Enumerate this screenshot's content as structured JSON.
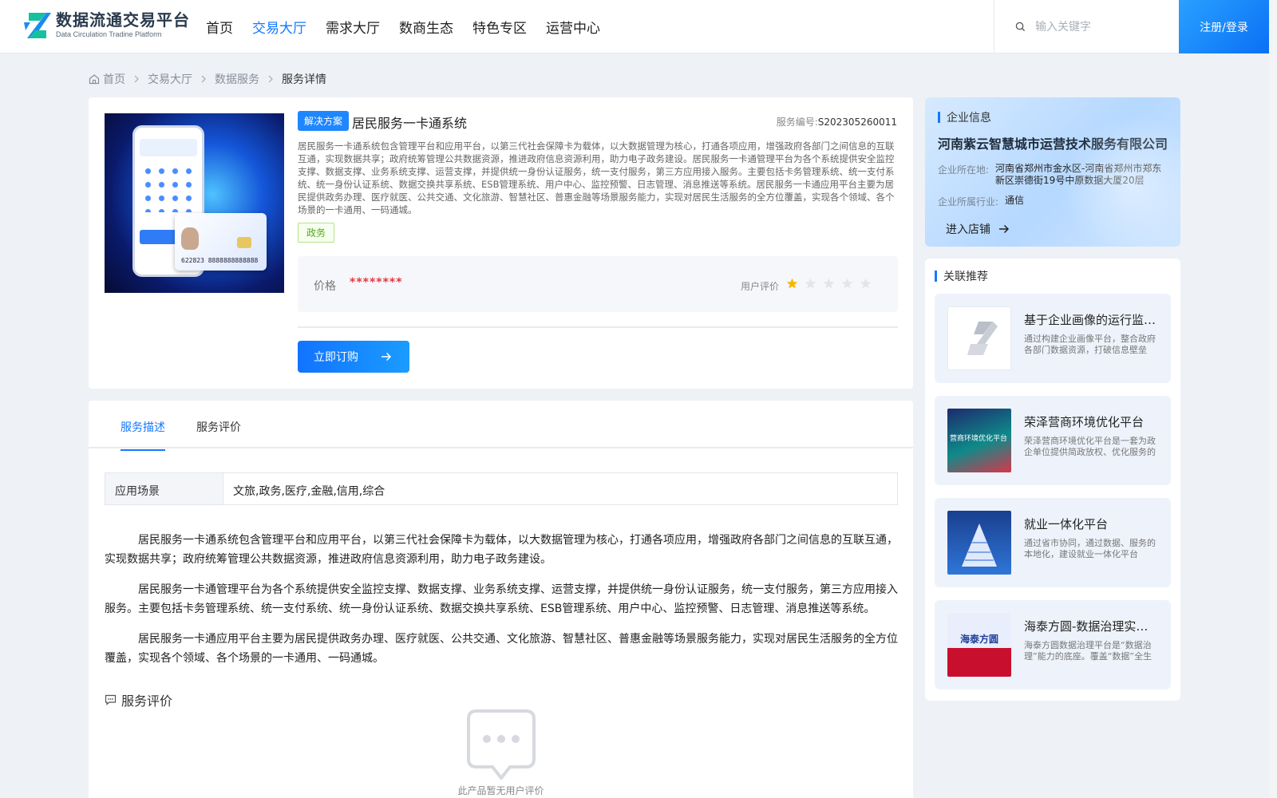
{
  "header": {
    "logo_title": "数据流通交易平台",
    "logo_subtitle": "Data Circulation Tradine Platform",
    "nav": [
      "首页",
      "交易大厅",
      "需求大厅",
      "数商生态",
      "特色专区",
      "运营中心"
    ],
    "nav_active_index": 1,
    "search_placeholder": "输入关键字",
    "login_label": "注册/登录"
  },
  "breadcrumb": [
    "首页",
    "交易大厅",
    "数据服务",
    "服务详情"
  ],
  "product": {
    "tag": "解决方案",
    "title": "居民服务一卡通系统",
    "service_no_label": "服务编号:",
    "service_no": "S202305260011",
    "description": "居民服务一卡通系统包含管理平台和应用平台，以第三代社会保障卡为载体，以大数据管理为核心，打通各项应用，增强政府各部门之间信息的互联互通，实现数据共享；政府统筹管理公共数据资源，推进政府信息资源利用，助力电子政务建设。居民服务一卡通管理平台为各个系统提供安全监控支撑、数据支撑、业务系统支撑、运营支撑，并提供统一身份认证服务，统一支付服务，第三方应用接入服务。主要包括卡务管理系统、统一支付系统、统一身份认证系统、数据交换共享系统、ESB管理系统、用户中心、监控预警、日志管理、消息推送等系统。居民服务一卡通应用平台主要为居民提供政务办理、医疗就医、公共交通、文化旅游、智慧社区、普惠金融等场景服务能力，实现对居民生活服务的全方位覆盖，实现各个领域、各个场景的一卡通用、一码通城。",
    "category_tag": "政务",
    "price_label": "价格",
    "price_value": "********",
    "rating_label": "用户评价",
    "rating": 1,
    "rating_max": 5,
    "buy_label": "立即订购",
    "card_number": "622823 8888888888888"
  },
  "tabs": [
    "服务描述",
    "服务评价"
  ],
  "scene": {
    "key": "应用场景",
    "value": "文旅,政务,医疗,金融,信用,综合"
  },
  "paragraphs": [
    "居民服务一卡通系统包含管理平台和应用平台，以第三代社会保障卡为载体，以大数据管理为核心，打通各项应用，增强政府各部门之间信息的互联互通，实现数据共享；政府统筹管理公共数据资源，推进政府信息资源利用，助力电子政务建设。",
    "居民服务一卡通管理平台为各个系统提供安全监控支撑、数据支撑、业务系统支撑、运营支撑，并提供统一身份认证服务，统一支付服务，第三方应用接入服务。主要包括卡务管理系统、统一支付系统、统一身份认证系统、数据交换共享系统、ESB管理系统、用户中心、监控预警、日志管理、消息推送等系统。",
    "居民服务一卡通应用平台主要为居民提供政务办理、医疗就医、公共交通、文化旅游、智慧社区、普惠金融等场景服务能力，实现对居民生活服务的全方位覆盖，实现各个领域、各个场景的一卡通用、一码通城。"
  ],
  "evaluation": {
    "title": "服务评价",
    "empty_text": "此产品暂无用户评价"
  },
  "company": {
    "section_title": "企业信息",
    "name": "河南紫云智慧城市运营技术服务有限公司",
    "location_label": "企业所在地:",
    "location": "河南省郑州市金水区-河南省郑州市郑东新区崇德街19号中原数据大厦20层",
    "industry_label": "企业所属行业:",
    "industry": "通信",
    "enter_label": "进入店铺"
  },
  "recommend": {
    "section_title": "关联推荐",
    "items": [
      {
        "title": "基于企业画像的运行监测平台",
        "desc": "通过构建企业画像平台，整合政府各部门数据资源，打破信息壁垒",
        "thumb": "logo"
      },
      {
        "title": "荣泽营商环境优化平台",
        "desc": "荣泽营商环境优化平台是一套为政企单位提供简政放权、优化服务的平台",
        "thumb": "营商环境优化平台"
      },
      {
        "title": "就业一体化平台",
        "desc": "通过省市协同，通过数据、服务的本地化，建设就业一体化平台",
        "thumb": "pyramid"
      },
      {
        "title": "海泰方圆-数据治理实施服务",
        "desc": "海泰方圆数据治理平台是“数据治理”能力的底座。覆盖“数据”全生命周期",
        "thumb": "海泰方圆"
      }
    ]
  },
  "colors": {
    "accent": "#1677ff",
    "price": "#e6353f",
    "star": "#f5b800"
  }
}
